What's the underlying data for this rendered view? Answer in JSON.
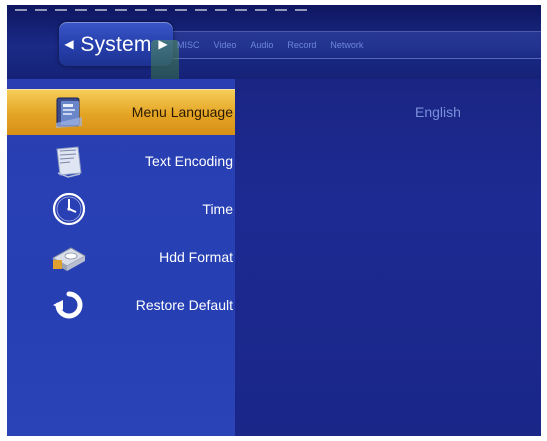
{
  "header": {
    "active_tab": "System",
    "tabs": [
      "MISC",
      "Video",
      "Audio",
      "Record",
      "Network"
    ]
  },
  "menu": {
    "items": [
      {
        "label": "Menu Language",
        "icon": "language-book-icon",
        "selected": true
      },
      {
        "label": "Text Encoding",
        "icon": "text-encoding-book-icon",
        "selected": false
      },
      {
        "label": "Time",
        "icon": "clock-icon",
        "selected": false
      },
      {
        "label": "Hdd Format",
        "icon": "hard-disk-icon",
        "selected": false
      },
      {
        "label": "Restore Default",
        "icon": "restore-arrow-icon",
        "selected": false
      }
    ]
  },
  "content": {
    "value": "English"
  },
  "colors": {
    "background": "#1d2a92",
    "menu_panel": "#2640b4",
    "selection": "#e5a524",
    "value_text": "#7a8fda"
  }
}
